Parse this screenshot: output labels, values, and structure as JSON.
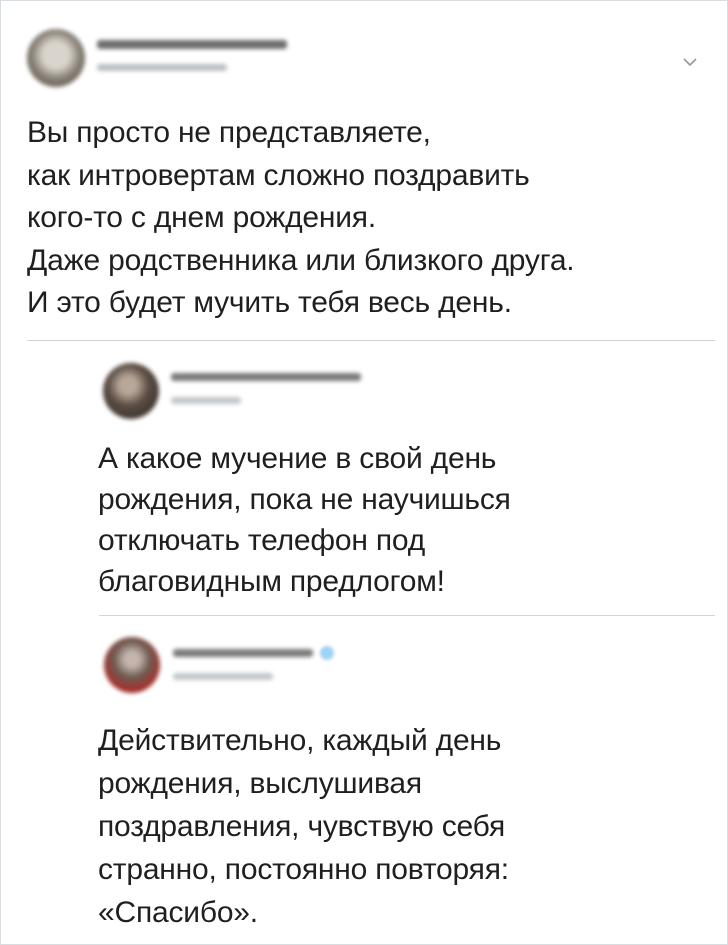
{
  "colors": {
    "text": "#1f1f1f",
    "divider": "#cfd6dc",
    "verified_badge": "#9fd3f5",
    "chevron": "#8a9aa6"
  },
  "icons": {
    "menu": "chevron-down-icon",
    "verified": "verified-badge-icon"
  },
  "main_tweet": {
    "lines": [
      "Вы просто не представляете,",
      "как интровертам сложно поздравить",
      "кого-то с днем рождения.",
      "Даже родственника или близкого друга.",
      "И это будет мучить тебя весь день."
    ]
  },
  "reply_1": {
    "lines": [
      "А какое мучение в свой день",
      "рождения, пока не научишься",
      "отключать телефон под",
      "благовидным предлогом!"
    ]
  },
  "reply_2": {
    "lines": [
      "Действительно, каждый день",
      "рождения, выслушивая",
      "поздравления, чувствую себя",
      "странно, постоянно повторяя:",
      "«Спасибо»."
    ]
  }
}
